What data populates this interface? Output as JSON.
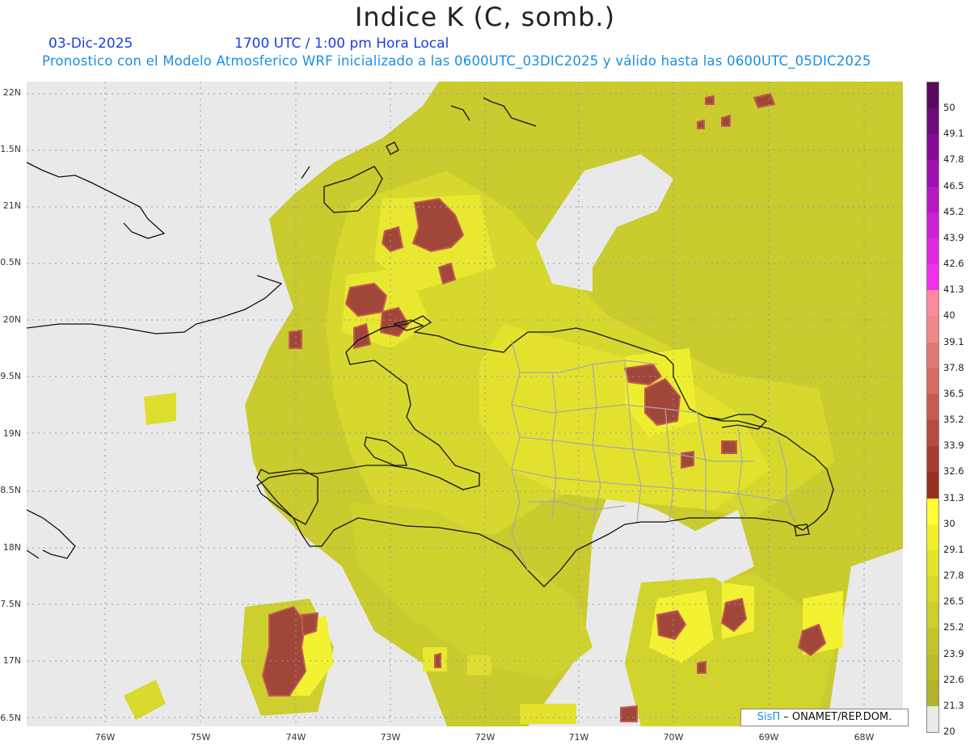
{
  "header": {
    "title": "Indice K (C, somb.)",
    "date": "03-Dic-2025",
    "time": "1700 UTC / 1:00 pm Hora Local",
    "subtitle": "Pronostico con el Modelo Atmosferico WRF inicializado a las 0600UTC_03DIC2025 y válido hasta las  0600UTC_05DIC2025"
  },
  "axes": {
    "y_labels": [
      "22N",
      "1.5N",
      "21N",
      "0.5N",
      "20N",
      "9.5N",
      "19N",
      "8.5N",
      "18N",
      "7.5N",
      "17N",
      "6.5N"
    ],
    "x_labels": [
      "76W",
      "75W",
      "74W",
      "73W",
      "72W",
      "71W",
      "70W",
      "69W",
      "68W"
    ]
  },
  "credit": {
    "brand": "SisΠ",
    "text": "– ONAMET/REP.DOM."
  },
  "colorbar": {
    "labels": [
      "50",
      "49.1",
      "47.8",
      "46.5",
      "45.2",
      "43.9",
      "42.6",
      "41.3",
      "40",
      "39.1",
      "37.8",
      "36.5",
      "35.2",
      "33.9",
      "32.6",
      "31.3",
      "30",
      "29.1",
      "27.8",
      "26.5",
      "25.2",
      "23.9",
      "22.6",
      "21.3",
      "20"
    ],
    "colors": [
      "#5a0a5e",
      "#6e0a7a",
      "#8a0a98",
      "#a010b0",
      "#b818c4",
      "#cc20d4",
      "#e028e0",
      "#f030ee",
      "#ff88a0",
      "#f08888",
      "#e07874",
      "#d86a62",
      "#c85a50",
      "#b84a40",
      "#a83a30",
      "#983020",
      "#ffff33",
      "#f0f02a",
      "#e4e42a",
      "#d8da2a",
      "#cccf2a",
      "#c2c52a",
      "#b8bc2a",
      "#b0b42a",
      "#e9e9e9"
    ]
  },
  "palette": {
    "land_20": "#c8c830",
    "land_25": "#dede30",
    "land_29": "#f4f432",
    "storm": "#a0473a",
    "storm_hi": "#c25a50",
    "no_data": "#e9e9e9",
    "coast": "#111111",
    "borders": "#a9a9a9"
  }
}
